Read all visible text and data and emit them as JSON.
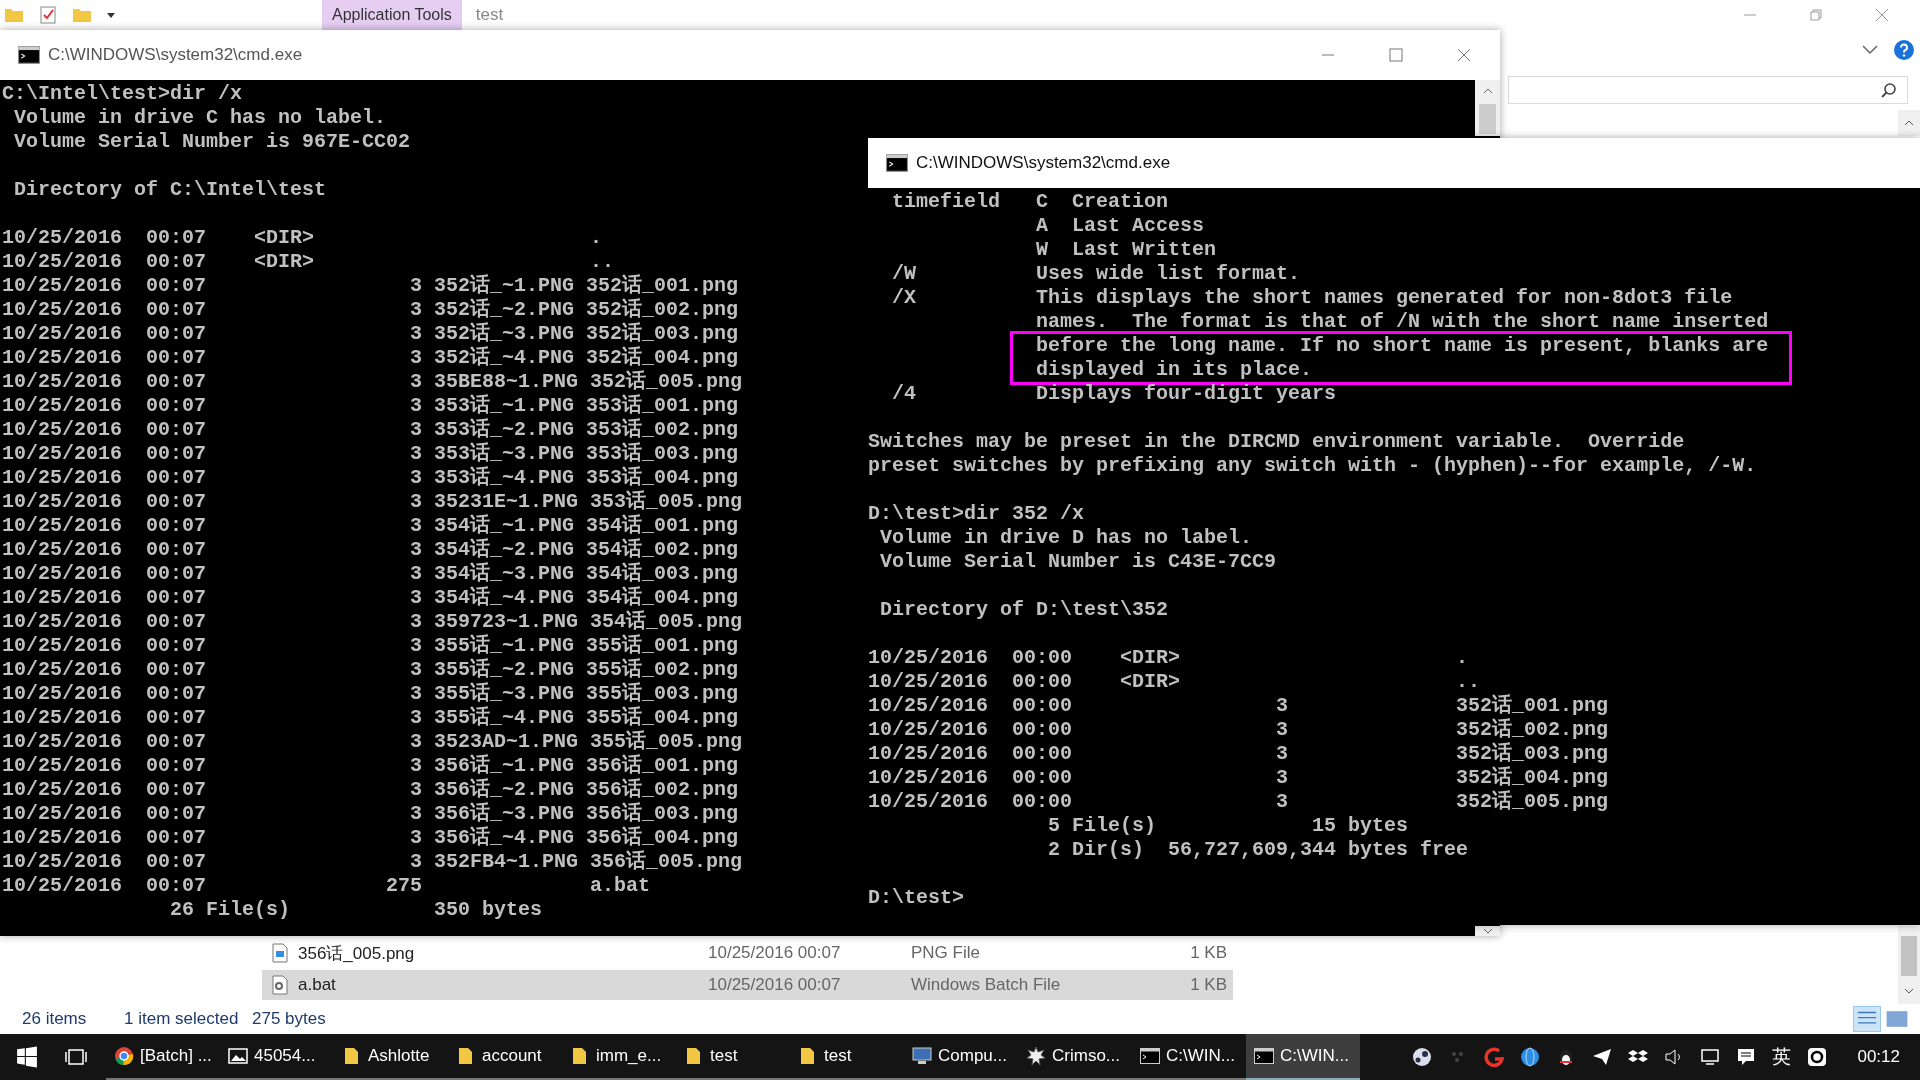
{
  "explorer": {
    "context_tab": "Application Tools",
    "title": "test",
    "files": [
      {
        "name": "356话_005.png",
        "date": "10/25/2016 00:07",
        "type": "PNG File",
        "size": "1 KB",
        "kind": "image",
        "selected": false
      },
      {
        "name": "a.bat",
        "date": "10/25/2016 00:07",
        "type": "Windows Batch File",
        "size": "1 KB",
        "kind": "batch",
        "selected": true
      }
    ],
    "status_bar": {
      "count": "26 items",
      "selection": "1 item selected",
      "size": "275 bytes"
    }
  },
  "console_windows": [
    {
      "title": "C:\\WINDOWS\\system32\\cmd.exe",
      "blocks": [
        [
          {
            "kind": "plain",
            "lines": [
              "C:\\Intel\\test>dir /x",
              " Volume in drive C has no label.",
              " Volume Serial Number is 967E-CC02"
            ]
          }
        ],
        [
          {
            "kind": "plain",
            "lines": [
              " Directory of C:\\Intel\\test"
            ]
          }
        ],
        [
          {
            "kind": "plain",
            "lines": [
              "10/25/2016  00:07    <DIR>                       .",
              "10/25/2016  00:07    <DIR>                       ..",
              "10/25/2016  00:07                 3 352话_~1.PNG 352话_001.png",
              "10/25/2016  00:07                 3 352话_~2.PNG 352话_002.png",
              "10/25/2016  00:07                 3 352话_~3.PNG 352话_003.png",
              "10/25/2016  00:07                 3 352话_~4.PNG 352话_004.png",
              "10/25/2016  00:07                 3 35BE88~1.PNG 352话_005.png",
              "10/25/2016  00:07                 3 353话_~1.PNG 353话_001.png",
              "10/25/2016  00:07                 3 353话_~2.PNG 353话_002.png",
              "10/25/2016  00:07                 3 353话_~3.PNG 353话_003.png",
              "10/25/2016  00:07                 3 353话_~4.PNG 353话_004.png",
              "10/25/2016  00:07                 3 35231E~1.PNG 353话_005.png",
              "10/25/2016  00:07                 3 354话_~1.PNG 354话_001.png",
              "10/25/2016  00:07                 3 354话_~2.PNG 354话_002.png",
              "10/25/2016  00:07                 3 354话_~3.PNG 354话_003.png",
              "10/25/2016  00:07                 3 354话_~4.PNG 354话_004.png",
              "10/25/2016  00:07                 3 359723~1.PNG 354话_005.png",
              "10/25/2016  00:07                 3 355话_~1.PNG 355话_001.png",
              "10/25/2016  00:07                 3 355话_~2.PNG 355话_002.png",
              "10/25/2016  00:07                 3 355话_~3.PNG 355话_003.png",
              "10/25/2016  00:07                 3 355话_~4.PNG 355话_004.png",
              "10/25/2016  00:07                 3 3523AD~1.PNG 355话_005.png",
              "10/25/2016  00:07                 3 356话_~1.PNG 356话_001.png",
              "10/25/2016  00:07                 3 356话_~2.PNG 356话_002.png",
              "10/25/2016  00:07                 3 356话_~3.PNG 356话_003.png",
              "10/25/2016  00:07                 3 356话_~4.PNG 356话_004.png",
              "10/25/2016  00:07                 3 352FB4~1.PNG 356话_005.png",
              "10/25/2016  00:07               275              a.bat",
              "              26 File(s)            350 bytes"
            ]
          }
        ]
      ]
    },
    {
      "title": "C:\\WINDOWS\\system32\\cmd.exe",
      "blocks": [
        [
          {
            "kind": "plain",
            "lines": [
              "  timefield   C  Creation",
              "              A  Last Access",
              "              W  Last Written",
              "  /W          Uses wide list format.",
              "  /X          This displays the short names generated for non-8dot3 file",
              "              names.  The format is that of /N with the short name inserted"
            ]
          },
          {
            "kind": "highlight",
            "lines": [
              "              before the long name. If no short name is present, blanks are",
              "              displayed in its place."
            ]
          },
          {
            "kind": "plain",
            "lines": [
              "  /4          Displays four-digit years"
            ]
          }
        ],
        [
          {
            "kind": "plain",
            "lines": [
              "Switches may be preset in the DIRCMD environment variable.  Override",
              "preset switches by prefixing any switch with - (hyphen)--for example, /-W."
            ]
          }
        ],
        [
          {
            "kind": "plain",
            "lines": [
              "D:\\test>dir 352 /x",
              " Volume in drive D has no label.",
              " Volume Serial Number is C43E-7CC9"
            ]
          }
        ],
        [
          {
            "kind": "plain",
            "lines": [
              " Directory of D:\\test\\352"
            ]
          }
        ],
        [
          {
            "kind": "plain",
            "lines": [
              "10/25/2016  00:00    <DIR>                       .",
              "10/25/2016  00:00    <DIR>                       ..",
              "10/25/2016  00:00                 3              352话_001.png",
              "10/25/2016  00:00                 3              352话_002.png",
              "10/25/2016  00:00                 3              352话_003.png",
              "10/25/2016  00:00                 3              352话_004.png",
              "10/25/2016  00:00                 3              352话_005.png",
              "               5 File(s)             15 bytes",
              "               2 Dir(s)  56,727,609,344 bytes free"
            ]
          }
        ],
        [
          {
            "kind": "plain",
            "lines": [
              "D:\\test>"
            ]
          }
        ]
      ]
    }
  ],
  "taskbar": {
    "apps": [
      {
        "label": "[Batch] ...",
        "kind": "browser",
        "active": false
      },
      {
        "label": "45054...",
        "kind": "image",
        "active": false
      },
      {
        "label": "Ashlotte",
        "kind": "folder",
        "active": false
      },
      {
        "label": "account",
        "kind": "folder",
        "active": false
      },
      {
        "label": "imm_e...",
        "kind": "folder",
        "active": false
      },
      {
        "label": "test",
        "kind": "folder",
        "active": false
      },
      {
        "label": "test",
        "kind": "folder",
        "active": false
      },
      {
        "label": "Compu...",
        "kind": "computer",
        "active": false
      },
      {
        "label": "Crimso...",
        "kind": "splash",
        "active": false
      },
      {
        "label": "C:\\WIN...",
        "kind": "console",
        "active": false
      },
      {
        "label": "C:\\WIN...",
        "kind": "console",
        "active": true
      }
    ],
    "ime": "英",
    "clock": "00:12"
  }
}
